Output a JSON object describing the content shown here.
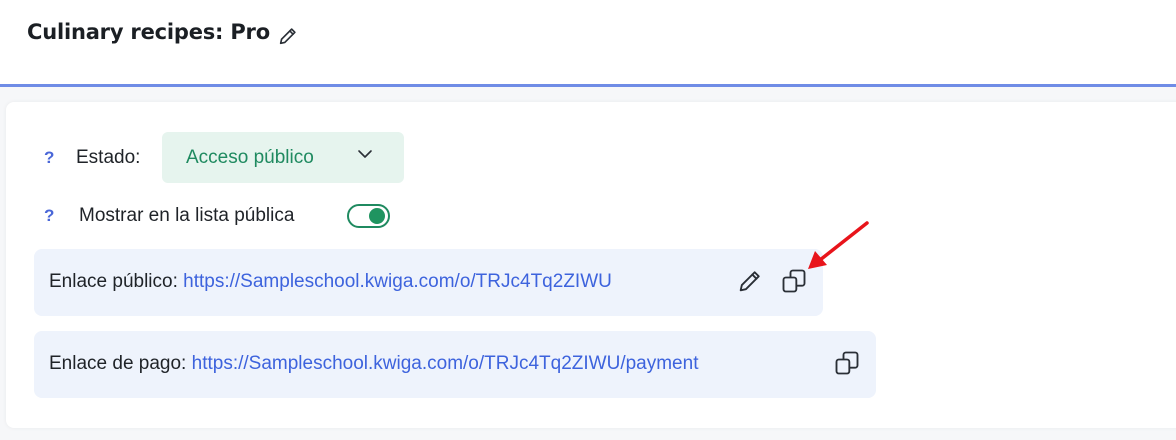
{
  "header": {
    "title": "Culinary recipes: Pro"
  },
  "status": {
    "help": "?",
    "label": "Estado:",
    "value": "Acceso público"
  },
  "public_list": {
    "help": "?",
    "label": "Mostrar en la lista pública",
    "enabled": true
  },
  "public_link": {
    "label": "Enlace público:",
    "url": "https://Sampleschool.kwiga.com/o/TRJc4Tq2ZIWU"
  },
  "payment_link": {
    "label": "Enlace de pago:",
    "url": "https://Sampleschool.kwiga.com/o/TRJc4Tq2ZIWU/payment"
  },
  "colors": {
    "accent": "#6f8ce6",
    "status_green": "#1f8a60",
    "link_blue": "#3d63dd",
    "annotation_red": "#e8141b"
  },
  "icons": [
    "pencil-icon",
    "chevron-down-icon",
    "copy-icon",
    "red-arrow-annotation"
  ]
}
